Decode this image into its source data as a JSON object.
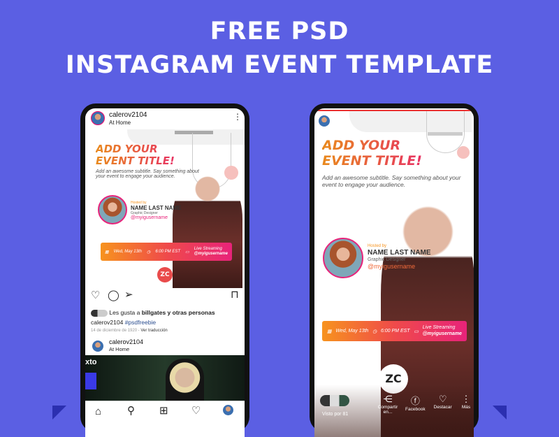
{
  "headline": {
    "line1": "FREE PSD",
    "line2": "INSTAGRAM EVENT TEMPLATE"
  },
  "colors": {
    "background": "#5b5fe3",
    "gradient_start": "#f7931e",
    "gradient_end": "#e8237a",
    "accent_pink": "#e8237a"
  },
  "feed": {
    "username": "calerov2104",
    "location": "At Home",
    "event": {
      "title_line1": "ADD YOUR",
      "title_line2": "EVENT TITLE!",
      "subtitle": "Add an awesome subtitle. Say something about your event to engage your audience.",
      "hosted_by": "Hosted by",
      "host_name": "NAME LAST NAME",
      "host_role": "Graphic Designer",
      "host_handle": "@myigusername",
      "date": "Wed, May 13th",
      "time": "6:00 PM EST",
      "stream_label": "Live Streaming",
      "stream_handle": "@myigusername",
      "logo": "ZC"
    },
    "likes_prefix": "Les gusta a ",
    "likes_user": "billgates",
    "likes_suffix": " y otras personas",
    "caption_user": "calerov2104",
    "caption_tag": "#psdfreebie",
    "date": "14 de diciembre de 1920",
    "translate": "· Ver traducción",
    "next_post": {
      "username": "calerov2104",
      "location": "At Home",
      "overlay_text": "xto"
    },
    "nav_icons": [
      "home-icon",
      "search-icon",
      "add-icon",
      "heart-icon",
      "profile-icon"
    ]
  },
  "story": {
    "event": {
      "title_line1": "ADD YOUR",
      "title_line2": "EVENT TITLE!",
      "subtitle": "Add an awesome subtitle. Say something about your event to engage your audience.",
      "hosted_by": "Hosted by",
      "host_name": "NAME LAST NAME",
      "host_role": "Graphic Designer",
      "host_handle": "@myigusername",
      "date": "Wed, May 13th",
      "time": "6:00 PM EST",
      "stream_label": "Live Streaming",
      "stream_handle": "@myigusername",
      "logo": "ZC"
    },
    "seen_by": "Visto por 81",
    "actions": [
      {
        "label": "Compartir en...",
        "icon": "share-icon"
      },
      {
        "label": "Facebook",
        "icon": "facebook-icon"
      },
      {
        "label": "Destacar",
        "icon": "highlight-icon"
      },
      {
        "label": "Más",
        "icon": "more-icon"
      }
    ]
  }
}
